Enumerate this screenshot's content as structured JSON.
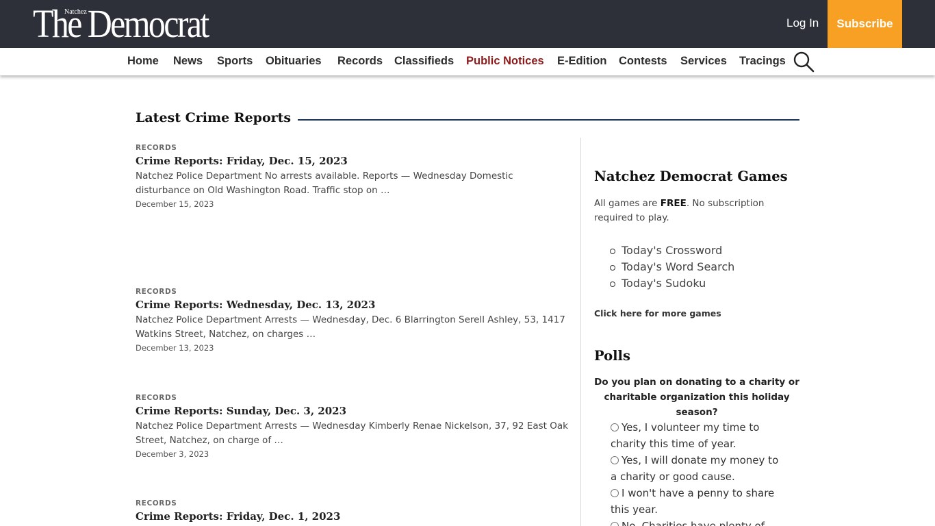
{
  "header": {
    "logo_small": "Natchez",
    "logo_main": "The Democrat",
    "login_label": "Log In",
    "subscribe_label": "Subscribe",
    "colors": {
      "bar": "#2d3039",
      "subscribe": "#f7a024"
    }
  },
  "nav": {
    "items": [
      {
        "label": "Home"
      },
      {
        "label": "News"
      },
      {
        "label": "Sports"
      },
      {
        "label": "Obituaries"
      },
      {
        "label": "Records"
      },
      {
        "label": "Classifieds"
      },
      {
        "label": "Public Notices",
        "active": true
      },
      {
        "label": "E-Edition"
      },
      {
        "label": "Contests"
      },
      {
        "label": "Services"
      },
      {
        "label": "Tracings"
      }
    ],
    "search_icon": "search-icon",
    "active_color": "#8b1a1a"
  },
  "main": {
    "section_title": "Latest Crime Reports",
    "articles": [
      {
        "category": "RECORDS",
        "title": "Crime Reports: Friday, Dec. 15, 2023",
        "excerpt": "Natchez Police Department No arrests available. Reports — Wednesday Domestic disturbance on Old Washington Road. Traffic stop on …",
        "date": "December 15, 2023"
      },
      {
        "category": "RECORDS",
        "title": "Crime Reports: Wednesday, Dec. 13, 2023",
        "excerpt": "Natchez Police Department Arrests — Wednesday, Dec. 6 Blarrington Serell Ashley, 53, 1417 Watkins Street, Natchez, on charges …",
        "date": "December 13, 2023"
      },
      {
        "category": "RECORDS",
        "title": "Crime Reports: Sunday, Dec. 3, 2023",
        "excerpt": "Natchez Police Department Arrests — Wednesday Kimberly Renae Nickelson, 37, 92 East Oak Street, Natchez, on charge of …",
        "date": "December 3, 2023"
      },
      {
        "category": "RECORDS",
        "title": "Crime Reports: Friday, Dec. 1, 2023",
        "excerpt": "",
        "date": ""
      }
    ]
  },
  "sidebar": {
    "games": {
      "title": "Natchez Democrat Games",
      "desc_prefix": "All games are ",
      "desc_bold": "FREE",
      "desc_suffix": ". No subscription required to play.",
      "items": [
        "Today's Crossword",
        "Today's Word Search",
        "Today's Sudoku"
      ],
      "more_link": "Click here for more games"
    },
    "polls": {
      "title": "Polls",
      "question": "Do you plan on donating to a charity or charitable organization this holiday season?",
      "options": [
        "Yes, I volunteer my time to charity this time of year.",
        "Yes, I will donate my money to a charity or good cause.",
        "I won't have a penny to share this year.",
        "No. Charities have plenty of"
      ]
    }
  }
}
